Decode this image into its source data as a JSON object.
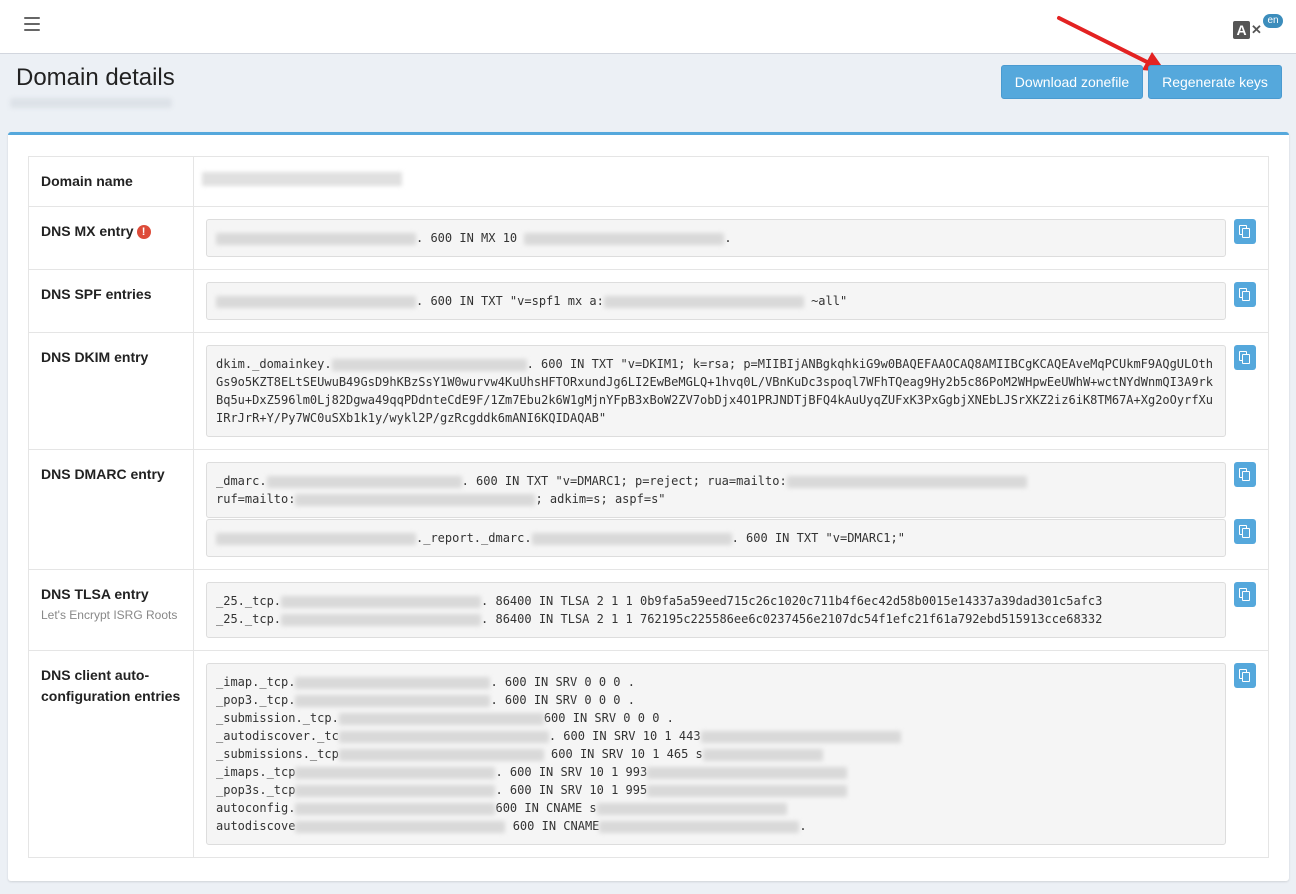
{
  "topbar": {
    "menu_icon": "hamburger-icon",
    "language": {
      "letter": "A",
      "badge": "en"
    }
  },
  "header": {
    "title": "Domain details",
    "download_label": "Download zonefile",
    "regenerate_label": "Regenerate keys"
  },
  "colors": {
    "accent": "#55a8dc",
    "warning": "#dd4b39",
    "arrow": "#e32222"
  },
  "rows": {
    "domain_name": {
      "label": "Domain name"
    },
    "mx": {
      "label": "DNS MX entry",
      "text1": ". 600 IN MX 10 ",
      "text2": "."
    },
    "spf": {
      "label": "DNS SPF entries",
      "text1": ". 600 IN TXT \"v=spf1 mx a:",
      "text2": " ~all\""
    },
    "dkim": {
      "label": "DNS DKIM entry",
      "prefix": "dkim._domainkey.",
      "text": ". 600 IN TXT \"v=DKIM1; k=rsa; p=MIIBIjANBgkqhkiG9w0BAQEFAAOCAQ8AMIIBCgKCAQEAveMqPCUkmF9AQgULOthGs9o5KZT8ELtSEUwuB49GsD9hKBzSsY1W0wurvw4KuUhsHFTORxundJg6LI2EwBeMGLQ+1hvq0L/VBnKuDc3spoql7WFhTQeag9Hy2b5c86PoM2WHpwEeUWhW+wctNYdWnmQI3A9rkBq5u+DxZ596lm0Lj82Dgwa49qqPDdnteCdE9F/1Zm7Ebu2k6W1gMjnYFpB3xBoW2ZV7obDjx4O1PRJNDTjBFQ4kAuUyqZUFxK3PxGgbjXNEbLJSrXKZ2iz6iK8TM67A+Xg2oOyrfXuIRrJrR+Y/Py7WC0uSXb1k1y/wykl2P/gzRcgddk6mANI6KQIDAQAB\""
    },
    "dmarc": {
      "label": "DNS DMARC entry",
      "prefix": "_dmarc.",
      "text1": ". 600 IN TXT \"v=DMARC1; p=reject; rua=mailto:",
      "line2_prefix": "ruf=mailto:",
      "text2": "; adkim=s; aspf=s\"",
      "report_text": "._report._dmarc.",
      "report_suffix": ". 600 IN TXT \"v=DMARC1;\""
    },
    "tlsa": {
      "label": "DNS TLSA entry",
      "sublabel": "Let's Encrypt ISRG Roots",
      "prefix": "_25._tcp.",
      "rec1": ". 86400 IN TLSA 2 1 1 0b9fa5a59eed715c26c1020c711b4f6ec42d58b0015e14337a39dad301c5afc3",
      "rec2": ". 86400 IN TLSA 2 1 1 762195c225586ee6c0237456e2107dc54f1efc21f61a792ebd515913cce68332"
    },
    "autoconfig": {
      "label": "DNS client auto-configuration entries",
      "lines": [
        {
          "pre": "_imap._tcp.",
          "post": ". 600 IN SRV 0 0 0 ."
        },
        {
          "pre": "_pop3._tcp.",
          "post": ". 600 IN SRV 0 0 0 ."
        },
        {
          "pre": "_submission._tcp.",
          "post": "600 IN SRV 0 0 0 ."
        },
        {
          "pre": "_autodiscover._tc",
          "post": ". 600 IN SRV 10 1 443"
        },
        {
          "pre": "_submissions._tcp",
          "post": " 600 IN SRV 10 1 465 s"
        },
        {
          "pre": "_imaps._tcp",
          "post": ". 600 IN SRV 10 1 993"
        },
        {
          "pre": "_pop3s._tcp",
          "post": ". 600 IN SRV 10 1 995"
        },
        {
          "pre": "autoconfig.",
          "post": "600 IN CNAME s"
        },
        {
          "pre": "autodiscove",
          "post": " 600 IN CNAME"
        }
      ]
    }
  }
}
